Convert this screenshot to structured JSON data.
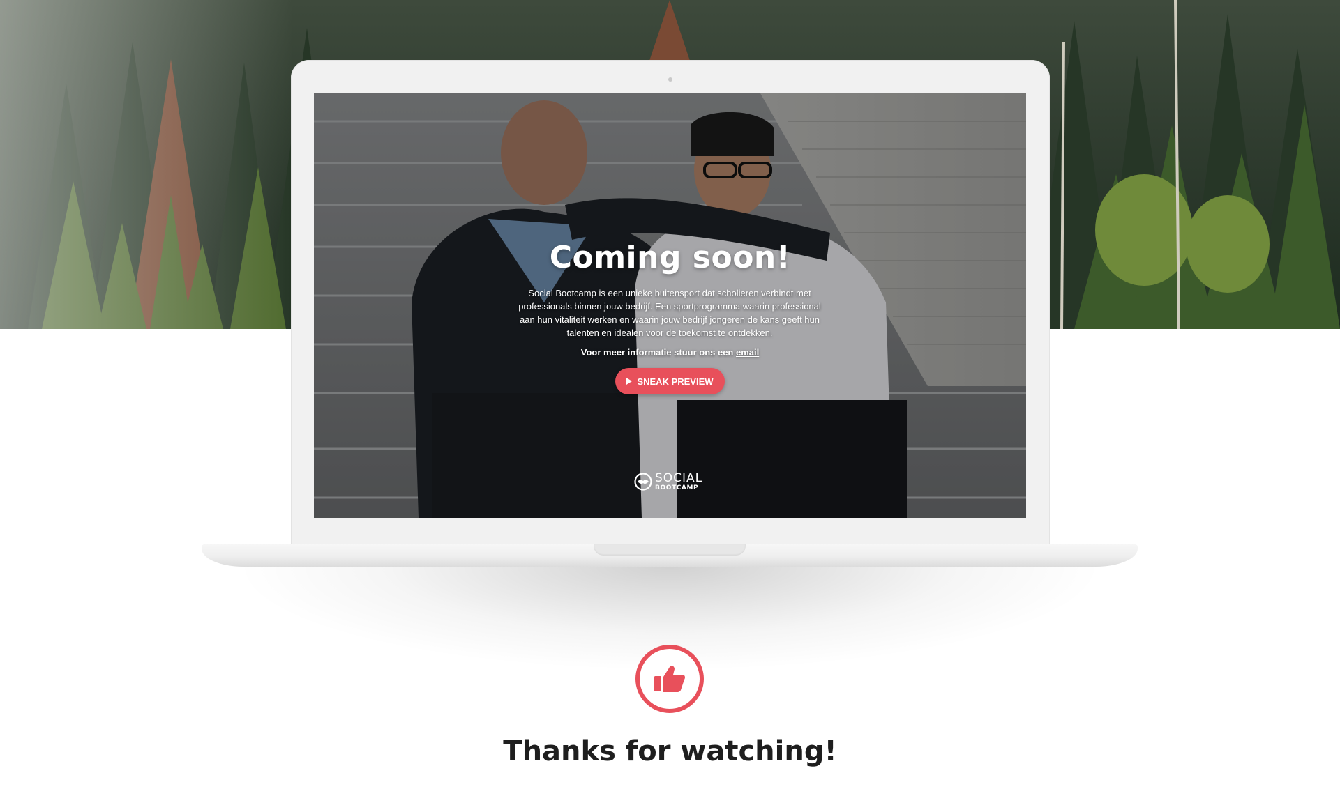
{
  "hero": {
    "title": "Coming soon!",
    "description": "Social Bootcamp is een unieke buitensport dat scholieren verbindt met professionals binnen jouw bedrijf. Een sportprogramma waarin professional aan hun vitaliteit werken en waarin jouw bedrijf jongeren de kans geeft hun talenten en idealen voor de toekomst te ontdekken.",
    "contact_prefix": "Voor meer informatie stuur ons een ",
    "contact_link": "email",
    "cta_label": "SNEAK PREVIEW"
  },
  "brand": {
    "line1": "SOCIAL",
    "line2": "BOOTCAMP"
  },
  "footer": {
    "message": "Thanks for watching!"
  },
  "icons": {
    "cta": "play-icon",
    "footer": "thumbs-up-icon",
    "brand": "handshake-logo-icon"
  },
  "colors": {
    "accent": "#e8505b",
    "heading": "#1e1e1e",
    "laptop": "#f1f1f1"
  }
}
